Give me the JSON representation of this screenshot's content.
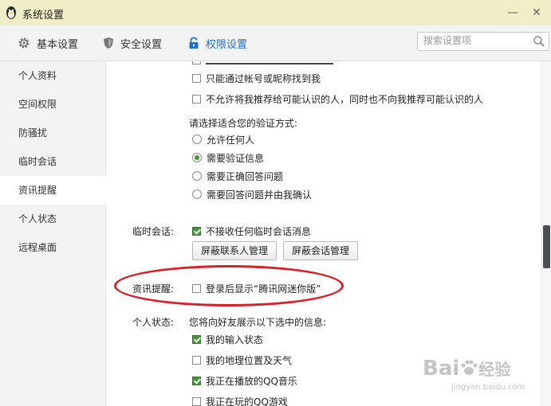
{
  "window": {
    "title": "系统设置"
  },
  "toolbar": {
    "tabs": [
      {
        "label": "基本设置",
        "icon": "gear-icon"
      },
      {
        "label": "安全设置",
        "icon": "shield-icon"
      },
      {
        "label": "权限设置",
        "icon": "lock-icon",
        "active": true
      }
    ],
    "search_placeholder": "搜索设置项"
  },
  "sidebar": {
    "items": [
      {
        "label": "个人资料"
      },
      {
        "label": "空间权限"
      },
      {
        "label": "防骚扰"
      },
      {
        "label": "临时会话"
      },
      {
        "label": "资讯提醒",
        "selected": true
      },
      {
        "label": "个人状态"
      },
      {
        "label": "远程桌面"
      }
    ]
  },
  "content": {
    "search_options": [
      {
        "label": "只能通过帐号或昵称找到我",
        "checked": false
      },
      {
        "label": "不允许将我推荐给可能认识的人，同时也不向我推荐可能认识的人",
        "checked": false
      }
    ],
    "verify_prompt": "请选择适合您的验证方式:",
    "verify_options": [
      {
        "label": "允许任何人",
        "selected": false
      },
      {
        "label": "需要验证信息",
        "selected": true
      },
      {
        "label": "需要正确回答问题",
        "selected": false
      },
      {
        "label": "需要回答问题并由我确认",
        "selected": false
      }
    ],
    "temp_session": {
      "label": "临时会话:",
      "option": "不接收任何临时会话消息",
      "checked": true,
      "buttons": [
        "屏蔽联系人管理",
        "屏蔽会话管理"
      ]
    },
    "news": {
      "label": "资讯提醒:",
      "option": "登录后显示“腾讯网迷你版”",
      "checked": false
    },
    "status": {
      "label": "个人状态:",
      "prompt": "您将向好友展示以下选中的信息:",
      "options": [
        {
          "label": "我的输入状态",
          "checked": true
        },
        {
          "label": "我的地理位置及天气",
          "checked": false
        },
        {
          "label": "我正在播放的QQ音乐",
          "checked": true
        },
        {
          "label": "我正在玩的QQ游戏",
          "checked": false
        }
      ]
    }
  },
  "watermark": {
    "brand": "Bai",
    "brand_cn": "经验",
    "url": "jingyan.baidu.com"
  },
  "colors": {
    "accent": "#1f6fd1",
    "check_green": "#3b9a2a",
    "annotation_red": "#d8202a",
    "titlebar": "#f1edc6"
  }
}
